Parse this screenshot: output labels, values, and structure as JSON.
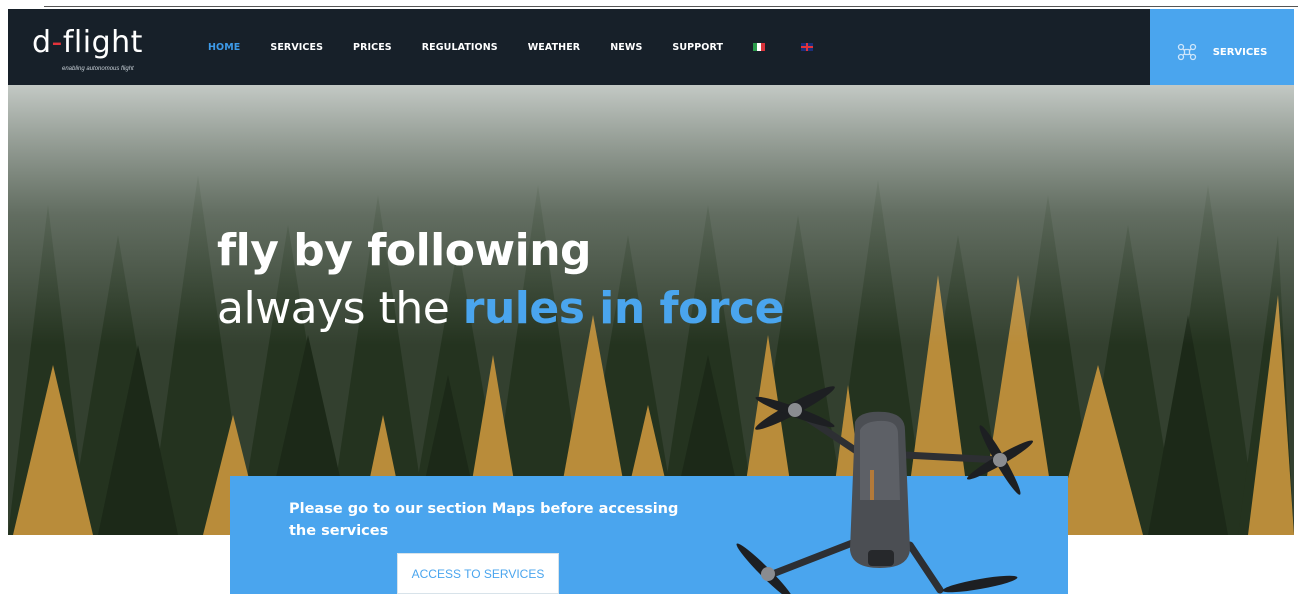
{
  "brand": {
    "name_prefix": "d",
    "name_dash": "-",
    "name_suffix": "flight",
    "tagline": "enabling autonomous flight"
  },
  "nav": {
    "items": [
      {
        "label": "HOME",
        "active": true
      },
      {
        "label": "SERVICES",
        "active": false
      },
      {
        "label": "PRICES",
        "active": false
      },
      {
        "label": "REGULATIONS",
        "active": false
      },
      {
        "label": "WEATHER",
        "active": false
      },
      {
        "label": "NEWS",
        "active": false
      },
      {
        "label": "SUPPORT",
        "active": false
      }
    ],
    "languages": [
      "italian-flag-icon",
      "uk-flag-icon"
    ],
    "services_tab_label": "SERVICES",
    "services_tab_icon": "drone-icon"
  },
  "hero": {
    "line1": "fly by following",
    "line2_light": "always the ",
    "line2_accent": "rules in force"
  },
  "cta": {
    "text": "Please go to our section Maps before accessing the services",
    "button_label": "ACCESS TO SERVICES"
  },
  "colors": {
    "navbar_bg": "#172029",
    "accent": "#4aa5ee",
    "logo_dash": "#e3333b"
  }
}
